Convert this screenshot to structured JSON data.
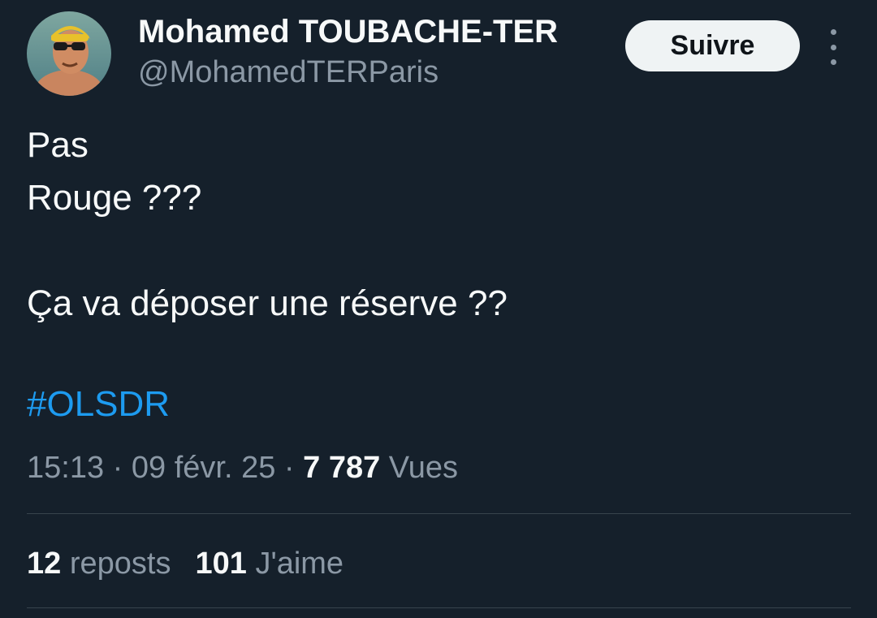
{
  "author": {
    "display_name": "Mohamed TOUBACHE-TER",
    "handle": "@MohamedTERParis",
    "avatar_icon": "profile-photo"
  },
  "follow_button": {
    "label": "Suivre"
  },
  "more_menu": {
    "icon": "more-vertical-icon"
  },
  "tweet": {
    "lines": [
      "Pas",
      "Rouge ???",
      "",
      "Ça va déposer une réserve ??"
    ],
    "hashtag": "#OLSDR"
  },
  "meta": {
    "time": "15:13",
    "separator": " · ",
    "date": "09 févr. 25",
    "views_count": "7 787",
    "views_label": "Vues"
  },
  "stats": {
    "reposts_count": "12",
    "reposts_label": "reposts",
    "likes_count": "101",
    "likes_label": "J'aime"
  },
  "colors": {
    "background": "#15202b",
    "text_primary": "#f7f9f9",
    "text_secondary": "#8b98a5",
    "link": "#1d9bf0",
    "divider": "#38444d",
    "button_bg": "#eff3f4"
  }
}
